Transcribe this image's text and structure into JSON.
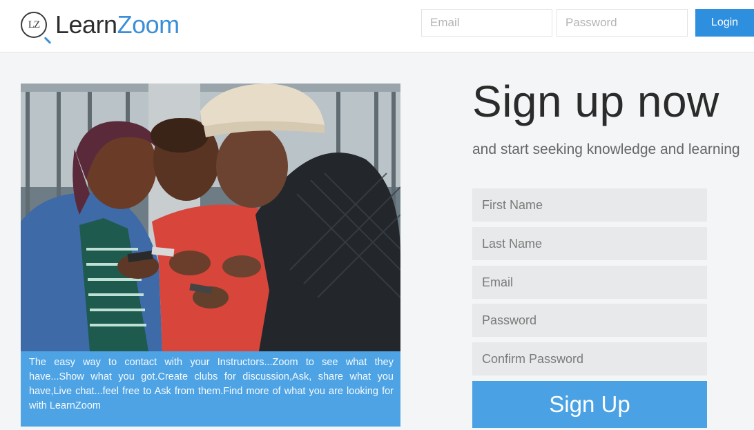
{
  "header": {
    "logo_badge": "LZ",
    "logo_learn": "Learn",
    "logo_zoom": "Zoom",
    "email_placeholder": "Email",
    "password_placeholder": "Password",
    "login_label": "Login"
  },
  "hero": {
    "caption": "The easy way to contact with your Instructors...Zoom to see what they have...Show what you got.Create clubs for discussion,Ask, share what you have,Live chat...feel free to Ask from them.Find more of what you are looking for with LearnZoom"
  },
  "signup": {
    "title": "Sign up now",
    "subtitle": "and start seeking knowledge and learning",
    "first_name_placeholder": "First Name",
    "last_name_placeholder": "Last Name",
    "email_placeholder": "Email",
    "password_placeholder": "Password",
    "confirm_password_placeholder": "Confirm Password",
    "submit_label": "Sign Up"
  },
  "colors": {
    "accent": "#2f8fdf",
    "caption_bg": "#4ea3e4",
    "field_bg": "#e8e9ea"
  }
}
